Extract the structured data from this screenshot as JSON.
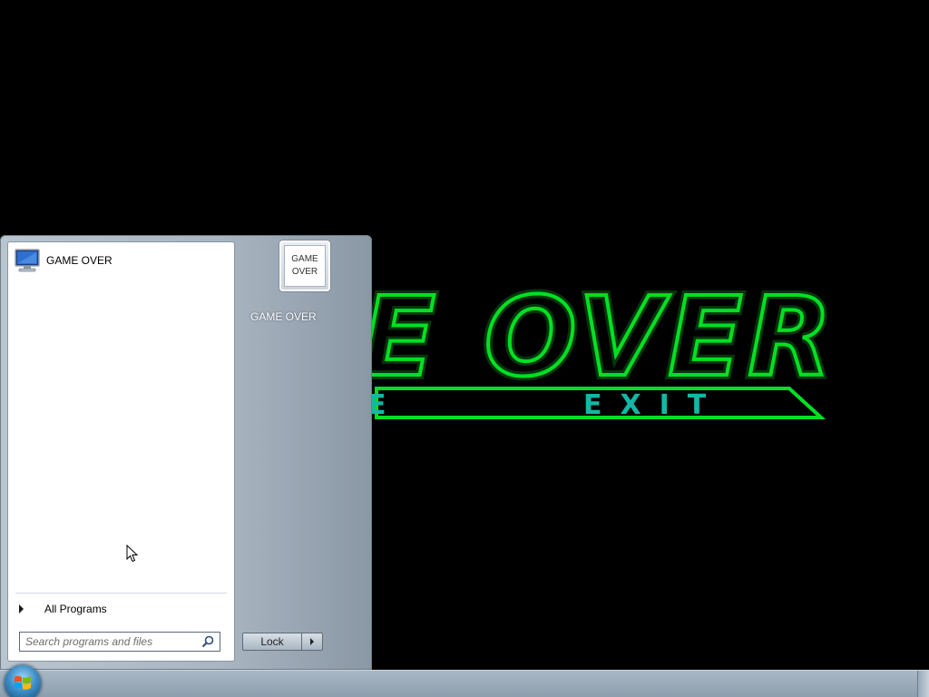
{
  "background": {
    "logo_text": "E OVER",
    "menu_left": "E",
    "menu_right": "EXIT",
    "logo_color": "#00e023",
    "menu_color": "#12b8a6"
  },
  "start_menu": {
    "pinned": [
      {
        "label": "GAME OVER",
        "icon": "computer-icon"
      }
    ],
    "all_programs_label": "All Programs",
    "search": {
      "placeholder": "Search programs and files",
      "value": ""
    },
    "user_tile_text_1": "GAME",
    "user_tile_text_2": "OVER",
    "user_name": "GAME OVER",
    "lock_label": "Lock"
  },
  "taskbar": {
    "start_icon": "windows-orb-icon"
  }
}
